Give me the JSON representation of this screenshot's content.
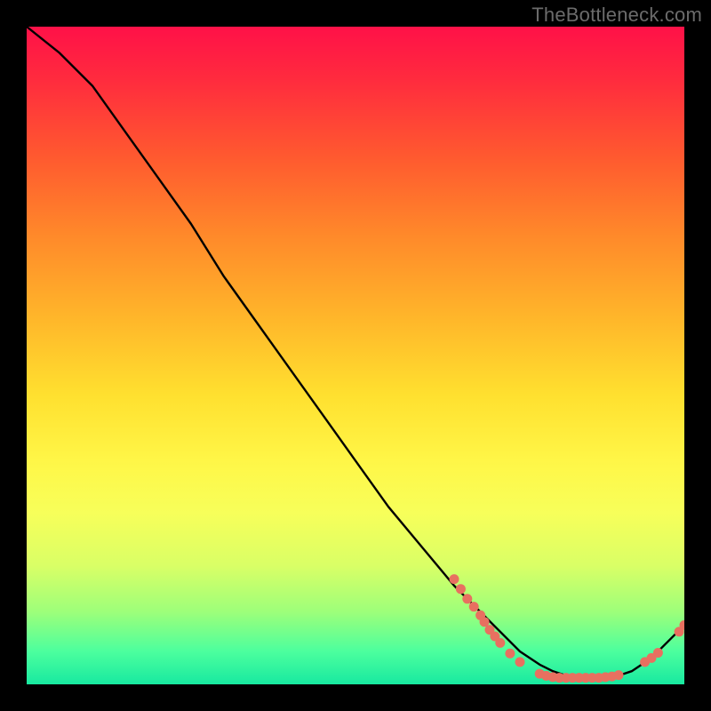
{
  "watermark": "TheBottleneck.com",
  "chart_data": {
    "type": "line",
    "title": "",
    "xlabel": "",
    "ylabel": "",
    "xlim": [
      0,
      100
    ],
    "ylim": [
      0,
      100
    ],
    "grid": false,
    "legend": false,
    "series": [
      {
        "name": "curve",
        "color": "#000000",
        "x": [
          0,
          5,
          10,
          15,
          20,
          25,
          30,
          35,
          40,
          45,
          50,
          55,
          60,
          65,
          70,
          75,
          78,
          80,
          83,
          86,
          89,
          92,
          95,
          98,
          100
        ],
        "y": [
          100,
          96,
          91,
          84,
          77,
          70,
          62,
          55,
          48,
          41,
          34,
          27,
          21,
          15,
          10,
          5,
          3,
          2,
          1,
          1,
          1,
          2,
          4,
          7,
          9
        ]
      }
    ],
    "scatter": {
      "name": "marks",
      "color": "#e87060",
      "points": [
        {
          "x": 65,
          "y": 16
        },
        {
          "x": 66,
          "y": 14.5
        },
        {
          "x": 67,
          "y": 13
        },
        {
          "x": 68,
          "y": 11.8
        },
        {
          "x": 69,
          "y": 10.5
        },
        {
          "x": 69.6,
          "y": 9.5
        },
        {
          "x": 70.4,
          "y": 8.3
        },
        {
          "x": 71.2,
          "y": 7.3
        },
        {
          "x": 72,
          "y": 6.3
        },
        {
          "x": 73.5,
          "y": 4.7
        },
        {
          "x": 75,
          "y": 3.4
        },
        {
          "x": 78,
          "y": 1.6
        },
        {
          "x": 79,
          "y": 1.3
        },
        {
          "x": 80,
          "y": 1.1
        },
        {
          "x": 81,
          "y": 1.0
        },
        {
          "x": 82,
          "y": 1.0
        },
        {
          "x": 83,
          "y": 1.0
        },
        {
          "x": 84,
          "y": 1.0
        },
        {
          "x": 85,
          "y": 1.0
        },
        {
          "x": 86,
          "y": 1.0
        },
        {
          "x": 87,
          "y": 1.0
        },
        {
          "x": 88,
          "y": 1.1
        },
        {
          "x": 89,
          "y": 1.2
        },
        {
          "x": 90,
          "y": 1.4
        },
        {
          "x": 94,
          "y": 3.4
        },
        {
          "x": 95,
          "y": 4.0
        },
        {
          "x": 96,
          "y": 4.8
        },
        {
          "x": 99.2,
          "y": 8.0
        },
        {
          "x": 100,
          "y": 9.0
        }
      ]
    }
  }
}
